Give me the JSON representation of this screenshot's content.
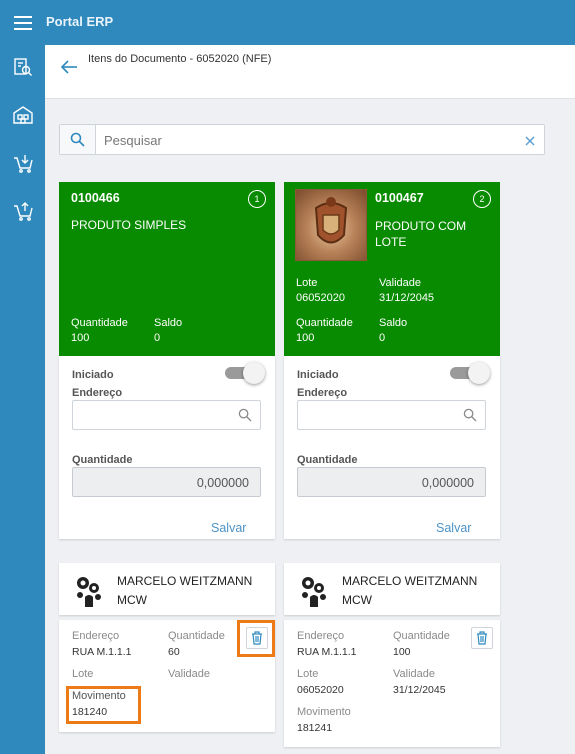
{
  "app": {
    "title": "Portal ERP"
  },
  "sidebar": {
    "items": [
      {
        "icon": "document-search-icon"
      },
      {
        "icon": "warehouse-icon"
      },
      {
        "icon": "inbound-cart-icon"
      },
      {
        "icon": "outbound-cart-icon"
      }
    ]
  },
  "header": {
    "title": "Itens do Documento - 6052020 (NFE)"
  },
  "search": {
    "placeholder": "Pesquisar"
  },
  "products": [
    {
      "code": "0100466",
      "index": "1",
      "name": "PRODUTO SIMPLES",
      "quantidade_label": "Quantidade",
      "quantidade": "100",
      "saldo_label": "Saldo",
      "saldo": "0",
      "iniciado_label": "Iniciado",
      "iniciado": true,
      "endereco_label": "Endereço",
      "endereco_value": "",
      "qty_label": "Quantidade",
      "qty_value": "0,000000",
      "save_label": "Salvar",
      "user": {
        "name": "MARCELO WEITZMANN",
        "abbr": "MCW"
      },
      "movement": {
        "endereco_label": "Endereço",
        "endereco": "RUA M.1.1.1",
        "quantidade_label": "Quantidade",
        "quantidade": "60",
        "lote_label": "Lote",
        "lote": "",
        "validade_label": "Validade",
        "validade": "",
        "movimento_label": "Movimento",
        "movimento": "181240"
      }
    },
    {
      "code": "0100467",
      "index": "2",
      "name_line1": "PRODUTO COM",
      "name_line2": "LOTE",
      "lote_label": "Lote",
      "lote": "06052020",
      "validade_label": "Validade",
      "validade": "31/12/2045",
      "quantidade_label": "Quantidade",
      "quantidade": "100",
      "saldo_label": "Saldo",
      "saldo": "0",
      "iniciado_label": "Iniciado",
      "iniciado": true,
      "endereco_label": "Endereço",
      "endereco_value": "",
      "qty_label": "Quantidade",
      "qty_value": "0,000000",
      "save_label": "Salvar",
      "user": {
        "name": "MARCELO WEITZMANN",
        "abbr": "MCW"
      },
      "movement": {
        "endereco_label": "Endereço",
        "endereco": "RUA M.1.1.1",
        "quantidade_label": "Quantidade",
        "quantidade": "100",
        "lote_label": "Lote",
        "lote": "06052020",
        "validade_label": "Validade",
        "validade": "31/12/2045",
        "movimento_label": "Movimento",
        "movimento": "181241"
      }
    }
  ],
  "colors": {
    "primary": "#2f89bd",
    "card_green": "#088b00",
    "link": "#4d93c7",
    "highlight": "#ec7a17"
  }
}
